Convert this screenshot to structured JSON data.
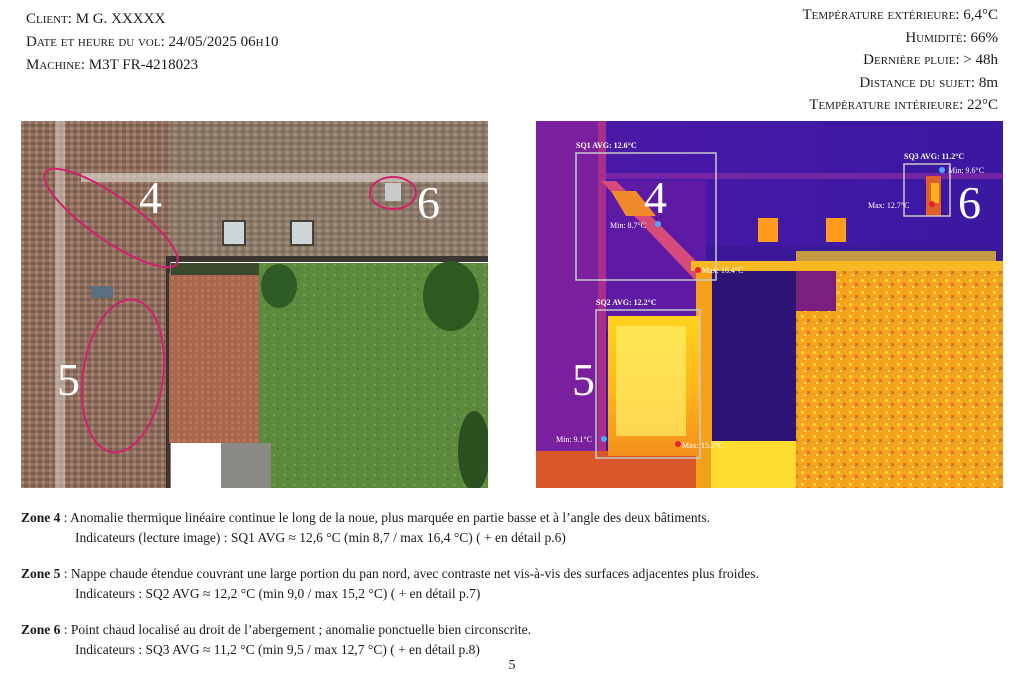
{
  "header": {
    "client_label": "Client",
    "client_value": ": M G. XXXXX",
    "date_label": "Date et heure du vol",
    "date_value": ": 24/05/2025 06h10",
    "machine_label": "Machine",
    "machine_value": ": M3T FR-4218023",
    "temp_ext_label": "Température extérieure",
    "temp_ext_value": ": 6,4°C",
    "humidity_label": "Humidité",
    "humidity_value": ": 66%",
    "rain_label": "Dernière pluie",
    "rain_value": ": > 48h",
    "distance_label": "Distance du sujet",
    "distance_value": ": 8m",
    "temp_int_label": "Température intérieure",
    "temp_int_value": ": 22°C"
  },
  "photo": {
    "zone_labels": [
      "4",
      "5",
      "6"
    ],
    "circle_color": "#d3206e"
  },
  "thermal": {
    "zone_labels": [
      "4",
      "5",
      "6"
    ],
    "sq1": {
      "label": "SQ1 AVG: 12.6°C",
      "min": "Min: 8.7°C",
      "max": "Max: 16.4°C"
    },
    "sq2": {
      "label": "SQ2 AVG: 12.2°C",
      "min": "Min: 9.1°C",
      "max": "Max: 15.2°C"
    },
    "sq3": {
      "label": "SQ3 AVG: 11.2°C",
      "min": "Min: 9.6°C",
      "max": "Max: 12.7°C"
    },
    "min_marker_color": "#4fa8ff",
    "max_marker_color": "#e8203a"
  },
  "zones": [
    {
      "title": "Zone 4",
      "description": " : Anomalie thermique linéaire continue le long de la noue, plus marquée en partie basse et à l’angle des deux bâtiments.",
      "indicators": "Indicateurs (lecture image) : SQ1 AVG ≈ 12,6 °C (min 8,7 / max 16,4 °C)  ( + en détail p.6)"
    },
    {
      "title": "Zone 5",
      "description": " : Nappe chaude étendue couvrant une large portion du pan nord, avec contraste net vis-à-vis des surfaces adjacentes plus froides.",
      "indicators": "Indicateurs : SQ2 AVG ≈ 12,2 °C (min 9,0 / max 15,2 °C) ( + en détail p.7)"
    },
    {
      "title": "Zone 6",
      "description": " : Point chaud localisé au droit de l’abergement ; anomalie ponctuelle bien circonscrite.",
      "indicators": "Indicateurs : SQ3 AVG ≈ 11,2 °C (min 9,5 / max 12,7 °C) ( + en détail p.8)"
    }
  ],
  "page_number": "5"
}
